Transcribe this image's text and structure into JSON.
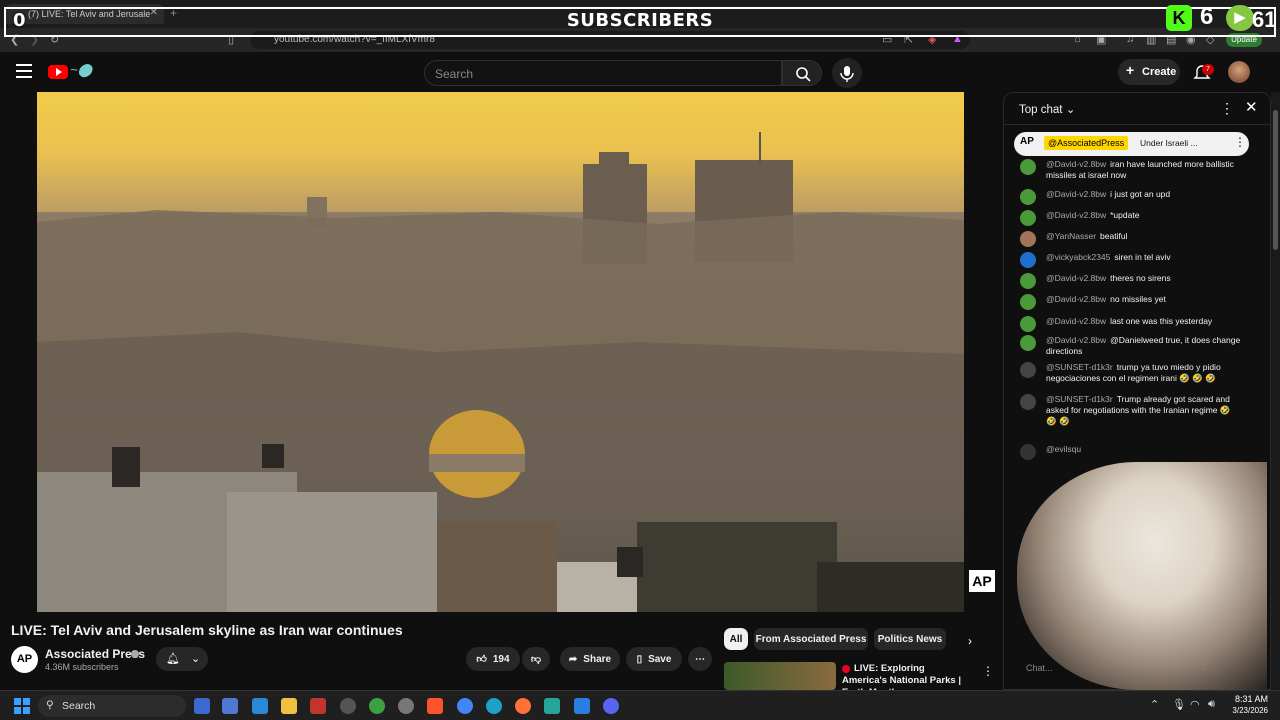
{
  "browser": {
    "tab_title": "(7) LIVE: Tel Aviv and Jerusale",
    "url": "youtube.com/watch?v=_IIMLXfVmr8",
    "update_label": "Update"
  },
  "overlay": {
    "left_count": "0",
    "title": "SUBSCRIBERS",
    "kick_count": "6",
    "rumble_count": "61"
  },
  "youtube": {
    "search_placeholder": "Search",
    "create_label": "Create",
    "notification_count": "7"
  },
  "video": {
    "title": "LIVE: Tel Aviv and Jerusalem skyline as Iran war continues",
    "watermark": "AP"
  },
  "channel": {
    "avatar_text": "AP",
    "name": "Associated Press",
    "subscribers": "4.36M subscribers"
  },
  "actions": {
    "likes": "194",
    "share_label": "Share",
    "save_label": "Save"
  },
  "chips": [
    "All",
    "From Associated Press",
    "Politics News"
  ],
  "recommended": {
    "title": "LIVE: Exploring America's National Parks | Earth Month ..."
  },
  "chat": {
    "mode_label": "Top chat",
    "pinned": {
      "logo": "AP",
      "user": "@AssociatedPress",
      "message": "Under Israeli ..."
    },
    "messages": [
      {
        "user": "@David-v2.8bw",
        "text": "iran have launched more ballistic missiles at israel now"
      },
      {
        "user": "@David-v2.8bw",
        "text": "i just got an upd"
      },
      {
        "user": "@David-v2.8bw",
        "text": "*update"
      },
      {
        "user": "@YanNasser",
        "text": "beatiful"
      },
      {
        "user": "@vickyabck2345",
        "text": "siren in tel aviv"
      },
      {
        "user": "@David-v2.8bw",
        "text": "theres no sirens"
      },
      {
        "user": "@David-v2.8bw",
        "text": "no missiles yet"
      },
      {
        "user": "@David-v2.8bw",
        "text": "last one was this yesterday"
      },
      {
        "user": "@David-v2.8bw",
        "text": "@Danielweed true, it does change directions"
      },
      {
        "user": "@SUNSET-d1k3r",
        "text": "trump ya tuvo miedo y pidio negociaciones con el regimen irani 🤣 🤣 🤣"
      },
      {
        "user": "@SUNSET-d1k3r",
        "text": "Trump already got scared and asked for negotiations with the Iranian regime 🤣 🤣 🤣"
      },
      {
        "user": "@evilsqu",
        "text": ""
      }
    ],
    "input_placeholder": "Chat..."
  },
  "taskbar": {
    "search_label": "Search",
    "time": "8:31 AM",
    "date": "3/23/2026"
  }
}
